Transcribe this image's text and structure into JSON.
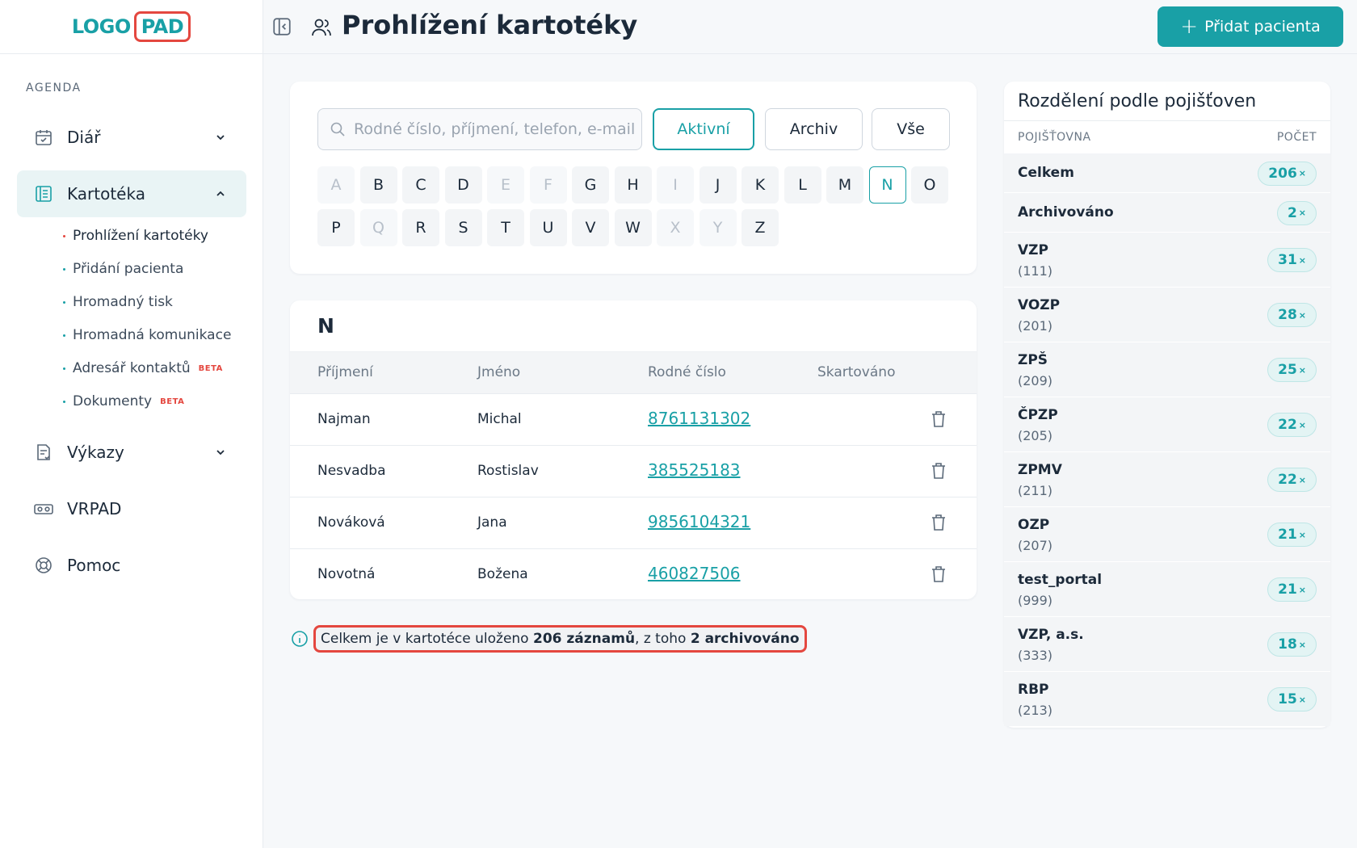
{
  "logo": {
    "part1": "LOGO",
    "part2": "PAD"
  },
  "sidebar": {
    "section": "AGENDA",
    "items": [
      {
        "label": "Diář",
        "icon": "calendar-icon"
      },
      {
        "label": "Kartotéka",
        "icon": "file-index-icon"
      },
      {
        "label": "Výkazy",
        "icon": "report-icon"
      },
      {
        "label": "VRPAD",
        "icon": "vr-headset-icon"
      },
      {
        "label": "Pomoc",
        "icon": "lifebuoy-icon"
      }
    ],
    "subitems": [
      {
        "label": "Prohlížení kartotéky"
      },
      {
        "label": "Přidání pacienta"
      },
      {
        "label": "Hromadný tisk"
      },
      {
        "label": "Hromadná komunikace"
      },
      {
        "label": "Adresář kontaktů",
        "badge": "BETA"
      },
      {
        "label": "Dokumenty",
        "badge": "BETA"
      }
    ]
  },
  "header": {
    "title": "Prohlížení kartotéky",
    "add_button": "Přidat pacienta"
  },
  "filter": {
    "search_placeholder": "Rodné číslo, příjmení, telefon, e-mail",
    "segments": [
      "Aktivní",
      "Archiv",
      "Vše"
    ],
    "letters_row1": [
      "A",
      "B",
      "C",
      "D",
      "E",
      "F",
      "G",
      "H",
      "I",
      "J",
      "K",
      "L",
      "M",
      "N",
      "O"
    ],
    "letters_row2": [
      "P",
      "Q",
      "R",
      "S",
      "T",
      "U",
      "V",
      "W",
      "X",
      "Y",
      "Z"
    ]
  },
  "table": {
    "group": "N",
    "columns": [
      "Příjmení",
      "Jméno",
      "Rodné číslo",
      "Skartováno"
    ],
    "rows": [
      {
        "surname": "Najman",
        "name": "Michal",
        "id": "8761131302"
      },
      {
        "surname": "Nesvadba",
        "name": "Rostislav",
        "id": "385525183"
      },
      {
        "surname": "Nováková",
        "name": "Jana",
        "id": "9856104321"
      },
      {
        "surname": "Novotná",
        "name": "Božena",
        "id": "460827506"
      }
    ]
  },
  "info": {
    "pre": "Celkem je v kartotéce uloženo ",
    "count": "206 záznamů",
    "mid": ", z toho ",
    "archived": "2 archivováno"
  },
  "insurance": {
    "title": "Rozdělení podle pojišťoven",
    "col1": "POJIŠŤOVNA",
    "col2": "POČET",
    "badge_suffix": "×",
    "rows": [
      {
        "name": "Celkem",
        "code": "",
        "count": "206"
      },
      {
        "name": "Archivováno",
        "code": "",
        "count": "2"
      },
      {
        "name": "VZP",
        "code": "(111)",
        "count": "31"
      },
      {
        "name": "VOZP",
        "code": "(201)",
        "count": "28"
      },
      {
        "name": "ZPŠ",
        "code": "(209)",
        "count": "25"
      },
      {
        "name": "ČPZP",
        "code": "(205)",
        "count": "22"
      },
      {
        "name": "ZPMV",
        "code": "(211)",
        "count": "22"
      },
      {
        "name": "OZP",
        "code": "(207)",
        "count": "21"
      },
      {
        "name": "test_portal",
        "code": "(999)",
        "count": "21"
      },
      {
        "name": "VZP, a.s.",
        "code": "(333)",
        "count": "18"
      },
      {
        "name": "RBP",
        "code": "(213)",
        "count": "15"
      }
    ]
  },
  "colors": {
    "accent": "#19a0a6",
    "highlight": "#e4473f"
  }
}
